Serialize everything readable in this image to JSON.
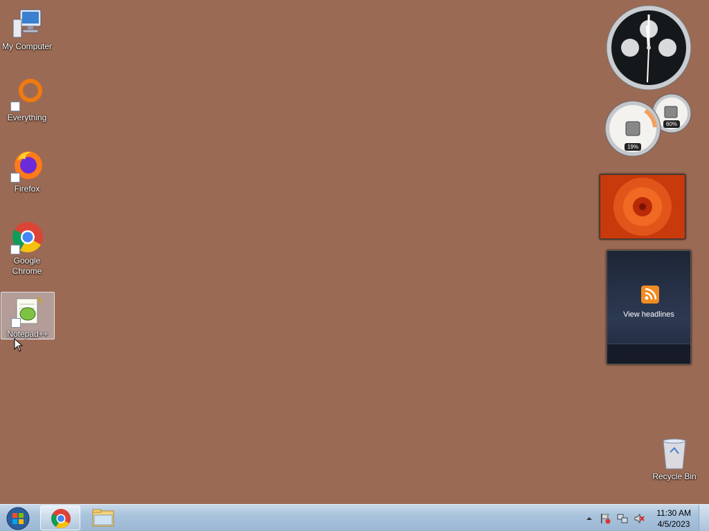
{
  "desktop": {
    "icons": [
      {
        "label": "My Computer",
        "icon": "computer-icon"
      },
      {
        "label": "Everything",
        "icon": "everything-icon"
      },
      {
        "label": "Firefox",
        "icon": "firefox-icon"
      },
      {
        "label": "Google Chrome",
        "icon": "chrome-icon"
      },
      {
        "label": "Notepad++",
        "icon": "notepadpp-icon"
      }
    ],
    "recycle_bin": {
      "label": "Recycle Bin",
      "icon": "recycle-bin-icon"
    }
  },
  "gadgets": {
    "cpu_meter": {
      "cpu": "19%",
      "memory": "60%"
    },
    "feed_headlines": {
      "label": "View headlines"
    }
  },
  "taskbar": {
    "clock_time": "11:30 AM",
    "clock_date": "4/5/2023",
    "tray_icons": [
      "show-hidden-icons",
      "action-center-flag-icon",
      "network-icon",
      "volume-muted-icon"
    ]
  },
  "colors": {
    "desktop_background": "#9b6a54"
  }
}
